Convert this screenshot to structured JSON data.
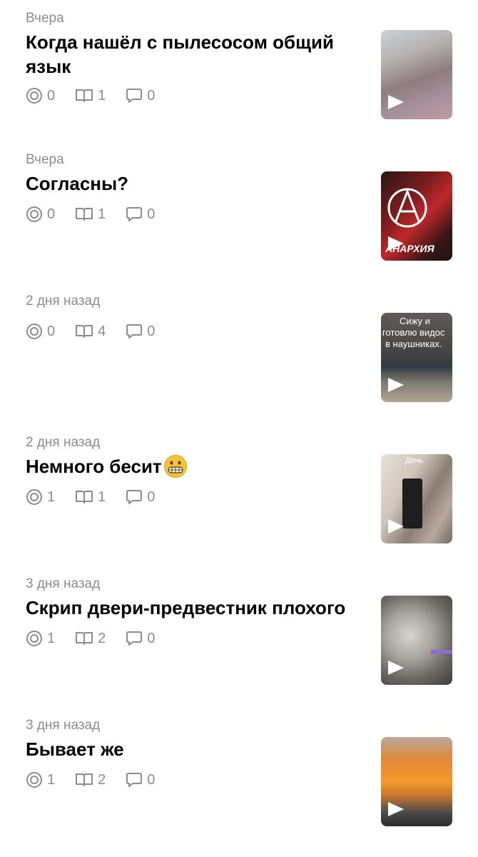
{
  "posts": [
    {
      "date": "Вчера",
      "title": "Когда нашёл с пылесосом общий язык",
      "views": "0",
      "reads": "1",
      "comments": "0"
    },
    {
      "date": "Вчера",
      "title": "Согласны?",
      "views": "0",
      "reads": "1",
      "comments": "0",
      "thumb_text": "АНАРХИЯ"
    },
    {
      "date": "2 дня назад",
      "title": "",
      "views": "0",
      "reads": "4",
      "comments": "0",
      "thumb_text_1": "Сижу и",
      "thumb_text_2": "готовлю видос",
      "thumb_text_3": "в наушниках."
    },
    {
      "date": "2 дня назад",
      "title": "Немного бесит",
      "title_emoji": "grimacing-face",
      "views": "1",
      "reads": "1",
      "comments": "0",
      "thumb_text": "День"
    },
    {
      "date": "3 дня назад",
      "title": "Скрип двери-предвестник плохого",
      "views": "1",
      "reads": "2",
      "comments": "0"
    },
    {
      "date": "3 дня назад",
      "title": "Бывает же",
      "views": "1",
      "reads": "2",
      "comments": "0"
    }
  ],
  "icons": {
    "views": "views-icon",
    "reads": "reads-icon",
    "comments": "comments-icon",
    "play": "play-icon"
  },
  "colors": {
    "meta_text": "#8c8c8c",
    "title_text": "#000000",
    "background": "#ffffff"
  }
}
